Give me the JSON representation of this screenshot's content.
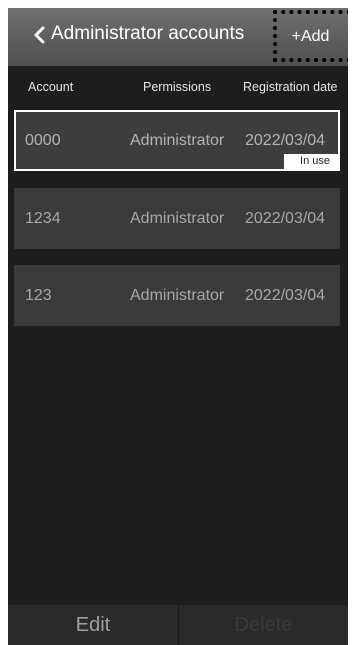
{
  "header": {
    "title": "Administrator accounts",
    "add_label": "+Add"
  },
  "columns": {
    "account": "Account",
    "permissions": "Permissions",
    "registration_date": "Registration date"
  },
  "accounts": [
    {
      "account": "0000",
      "permissions": "Administrator",
      "date": "2022/03/04",
      "badge": "In use",
      "selected": true
    },
    {
      "account": "1234",
      "permissions": "Administrator",
      "date": "2022/03/04"
    },
    {
      "account": "123",
      "permissions": "Administrator",
      "date": "2022/03/04"
    }
  ],
  "footer": {
    "edit_label": "Edit",
    "delete_label": "Delete"
  },
  "icons": {
    "back": "chevron-left-icon"
  }
}
